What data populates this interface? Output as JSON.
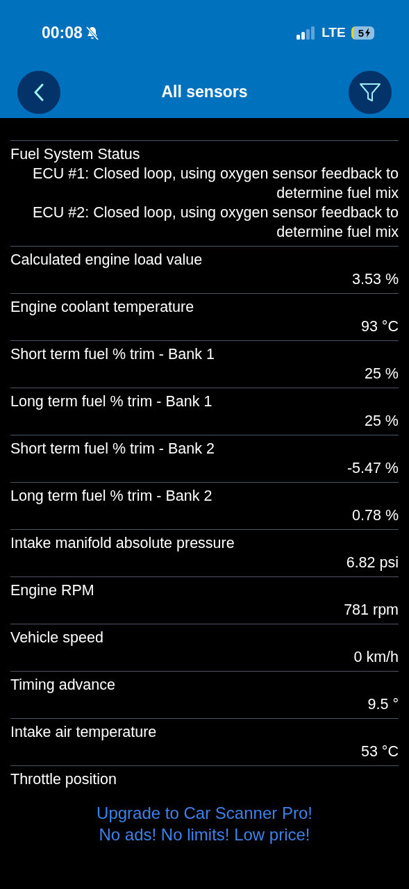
{
  "status_bar": {
    "time": "00:08",
    "network": "LTE",
    "battery": "5"
  },
  "header": {
    "title": "All sensors"
  },
  "sensors": [
    {
      "name": "Fuel System Status",
      "values": [
        "ECU #1: Closed loop, using oxygen sensor feedback to determine fuel mix",
        "ECU #2: Closed loop, using oxygen sensor feedback to determine fuel mix"
      ]
    },
    {
      "name": "Calculated engine load value",
      "value": "3.53 %"
    },
    {
      "name": "Engine coolant temperature",
      "value": "93 °C"
    },
    {
      "name": "Short term fuel % trim - Bank 1",
      "value": "25 %"
    },
    {
      "name": "Long term fuel % trim - Bank 1",
      "value": "25 %"
    },
    {
      "name": "Short term fuel % trim - Bank 2",
      "value": "-5.47 %"
    },
    {
      "name": "Long term fuel % trim - Bank 2",
      "value": "0.78 %"
    },
    {
      "name": "Intake manifold absolute pressure",
      "value": "6.82 psi"
    },
    {
      "name": "Engine RPM",
      "value": "781 rpm"
    },
    {
      "name": "Vehicle speed",
      "value": "0 km/h"
    },
    {
      "name": "Timing advance",
      "value": "9.5 °"
    },
    {
      "name": "Intake air temperature",
      "value": "53 °C"
    },
    {
      "name": "Throttle position"
    }
  ],
  "ad": {
    "lines": [
      "Upgrade to Car Scanner Pro!",
      "No ads! No limits! Low price!"
    ]
  }
}
